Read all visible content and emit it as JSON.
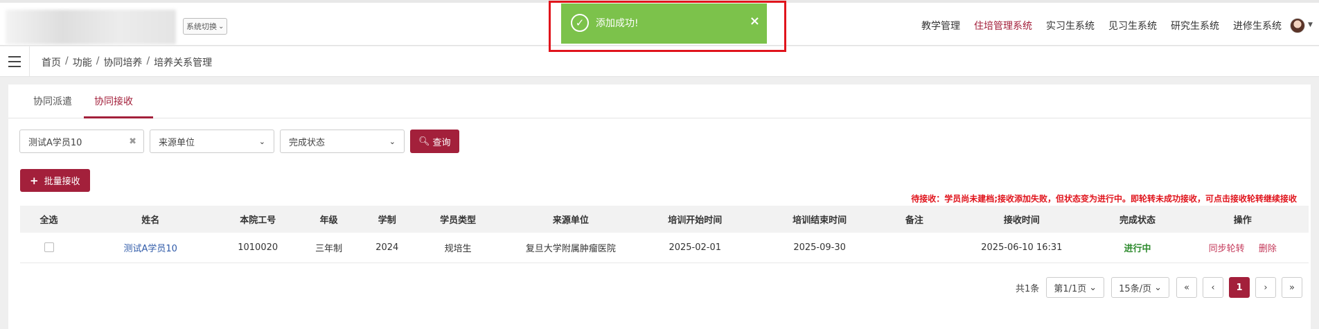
{
  "header": {
    "system_switch_label": "系统切换",
    "nav": [
      {
        "label": "教学管理",
        "active": false
      },
      {
        "label": "住培管理系统",
        "active": true
      },
      {
        "label": "实习生系统",
        "active": false
      },
      {
        "label": "见习生系统",
        "active": false
      },
      {
        "label": "研究生系统",
        "active": false
      },
      {
        "label": "进修生系统",
        "active": false
      }
    ]
  },
  "toast": {
    "message": "添加成功!",
    "close_symbol": "×"
  },
  "breadcrumb": [
    "首页",
    "功能",
    "协同培养",
    "培养关系管理"
  ],
  "tabs": [
    {
      "label": "协同派遣",
      "active": false
    },
    {
      "label": "协同接收",
      "active": true
    }
  ],
  "filters": {
    "search_value": "测试A学员10",
    "source_unit_placeholder": "来源单位",
    "status_placeholder": "完成状态",
    "query_label": "查询"
  },
  "batch_button_label": "批量接收",
  "notice": "待接收：学员尚未建档;接收添加失败，但状态变为进行中。即轮转未成功接收，可点击接收轮转继续接收",
  "table": {
    "columns": [
      "全选",
      "姓名",
      "本院工号",
      "年级",
      "学制",
      "学员类型",
      "来源单位",
      "培训开始时间",
      "培训结束时间",
      "备注",
      "接收时间",
      "完成状态",
      "操作"
    ],
    "rows": [
      {
        "name": "测试A学员10",
        "staff_no": "1010020",
        "grade": "三年制",
        "system": "2024",
        "type": "规培生",
        "source": "复旦大学附属肿瘤医院",
        "start": "2025-02-01",
        "end": "2025-09-30",
        "remark": "",
        "received_at": "2025-06-10 16:31",
        "status": "进行中",
        "actions": [
          "同步轮转",
          "删除"
        ]
      }
    ]
  },
  "pager": {
    "total": "共1条",
    "page_info": "第1/1页",
    "page_size": "15条/页",
    "first": "«",
    "prev": "‹",
    "current": "1",
    "next": "›",
    "last": "»"
  },
  "colors": {
    "accent": "#a3203b",
    "toast_bg": "#7cc24b",
    "status_ok": "#2e8b2e",
    "notice": "#e0141c"
  }
}
